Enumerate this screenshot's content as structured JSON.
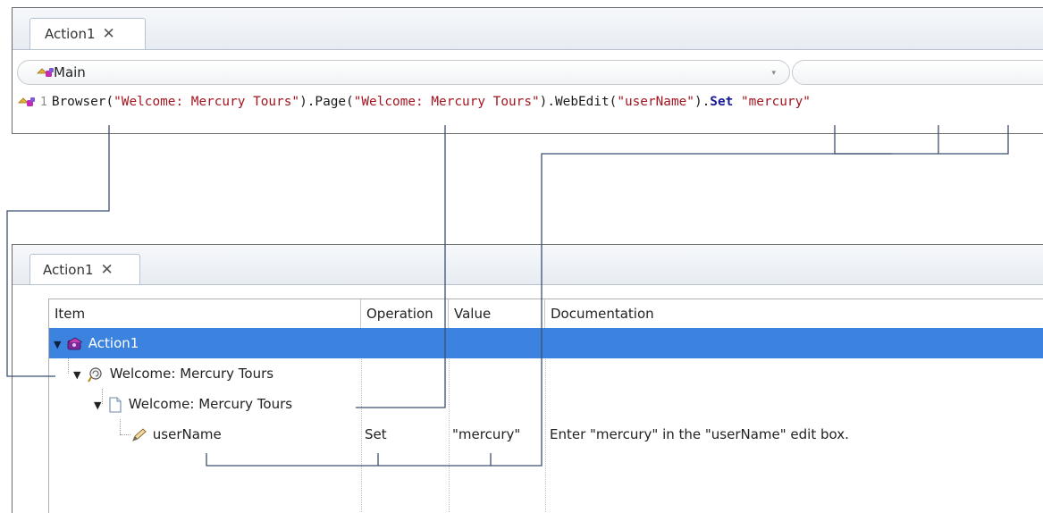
{
  "expert_view": {
    "tab_label": "Action1",
    "tab_close": "✕",
    "combo_label": "Main",
    "combo_arrow": "▾",
    "line_number": "1",
    "code": {
      "browser_fn": "Browser(",
      "browser_arg": "\"Welcome: Mercury Tours\"",
      "page_fn": ").Page(",
      "page_arg": "\"Welcome: Mercury Tours\"",
      "webedit_fn": ").WebEdit(",
      "webedit_arg": "\"userName\"",
      "dot": ").",
      "method": "Set",
      "space": " ",
      "value": "\"mercury\""
    }
  },
  "keyword_view": {
    "tab_label": "Action1",
    "tab_close": "✕",
    "columns": [
      "Item",
      "Operation",
      "Value",
      "Documentation"
    ],
    "rows": [
      {
        "item": "Action1",
        "operation": "",
        "value": "",
        "documentation": ""
      },
      {
        "item": "Welcome: Mercury Tours",
        "operation": "",
        "value": "",
        "documentation": ""
      },
      {
        "item": "Welcome: Mercury Tours",
        "operation": "",
        "value": "",
        "documentation": ""
      },
      {
        "item": "userName",
        "operation": "Set",
        "value": "\"mercury\"",
        "documentation": "Enter \"mercury\" in the \"userName\" edit box."
      }
    ]
  },
  "icons": {
    "action": "action-icon",
    "browser": "browser-icon",
    "page": "page-icon",
    "edit": "pencil-icon",
    "function": "function-icon"
  },
  "colors": {
    "selection": "#3c83e0",
    "string": "#a3151f",
    "keyword": "#1a1a96",
    "connector": "#3c4f70"
  }
}
